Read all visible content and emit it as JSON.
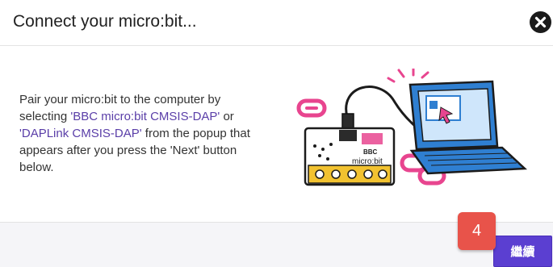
{
  "dialog": {
    "title": "Connect your micro:bit...",
    "description": {
      "part1": "Pair your micro:bit to the computer by selecting ",
      "link1": "'BBC micro:bit CMSIS-DAP'",
      "part2": " or ",
      "link2": "'DAPLink CMSIS-DAP'",
      "part3": " from the popup that appears after you press the 'Next' button below."
    },
    "illustration": {
      "board_label": "micro:bit",
      "board_brand": "BBC"
    },
    "next_label": "繼續",
    "close_icon": "close-icon"
  },
  "step_badge": "4",
  "colors": {
    "accent": "#5b3fd1",
    "link": "#5a3ea8",
    "badge": "#e8534a",
    "laptop": "#2f7fd1",
    "board": "#f2c230",
    "pink": "#e8458f"
  }
}
